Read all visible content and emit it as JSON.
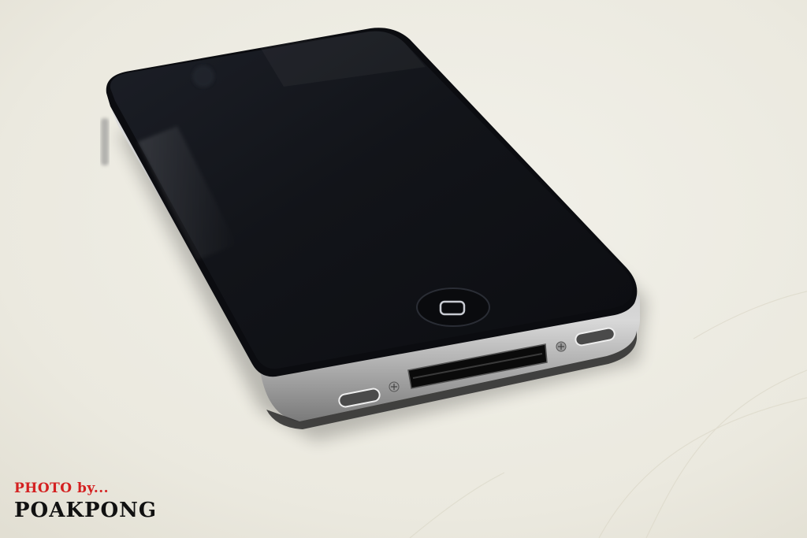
{
  "photo": {
    "subject": "iPhone 4 lying on a light wooden table",
    "colors": {
      "table": "#eeece3",
      "glass": "#14161c",
      "steel_band": "#c9c9c9"
    }
  },
  "watermark": {
    "line1": "PHOTO by...",
    "line2": "POAKPONG"
  }
}
